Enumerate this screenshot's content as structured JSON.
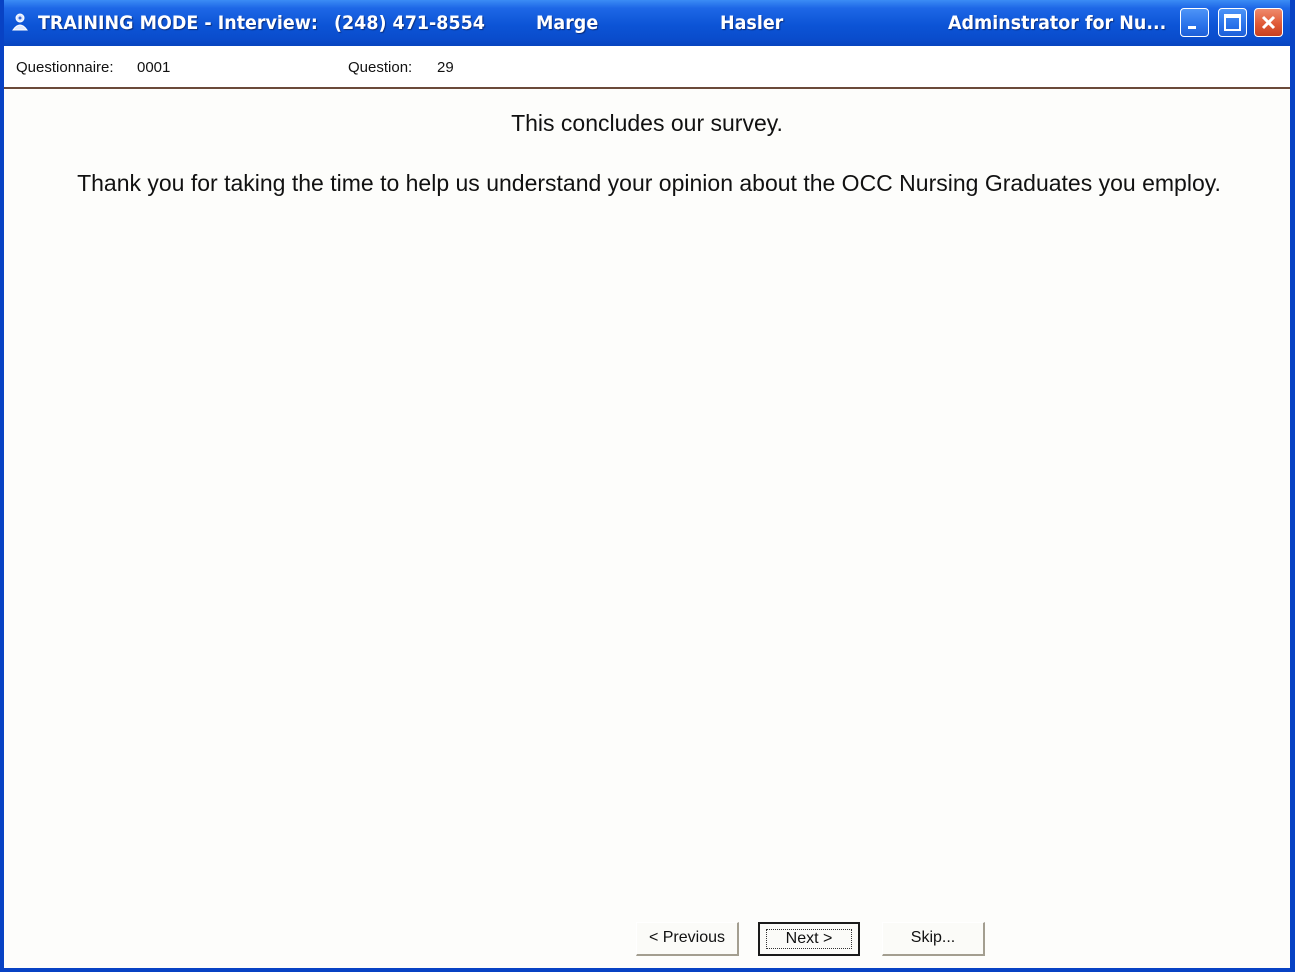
{
  "window": {
    "title_mode": "TRAINING MODE - Interview:",
    "title_phone": "(248) 471-8554",
    "title_first_name": "Marge",
    "title_last_name": "Hasler",
    "title_role": "Adminstrator for Nu..."
  },
  "info": {
    "questionnaire_label": "Questionnaire:",
    "questionnaire_value": "0001",
    "question_label": "Question:",
    "question_value": "29"
  },
  "content": {
    "line1": "This concludes our survey.",
    "line2": "Thank you for taking the time to help us understand your opinion about the OCC Nursing Graduates you employ."
  },
  "buttons": {
    "previous": "< Previous",
    "next": "Next >",
    "skip": "Skip..."
  },
  "colors": {
    "titlebar": "#0c54d6",
    "close_button": "#e05a37",
    "client_background": "#fdfdfb"
  }
}
